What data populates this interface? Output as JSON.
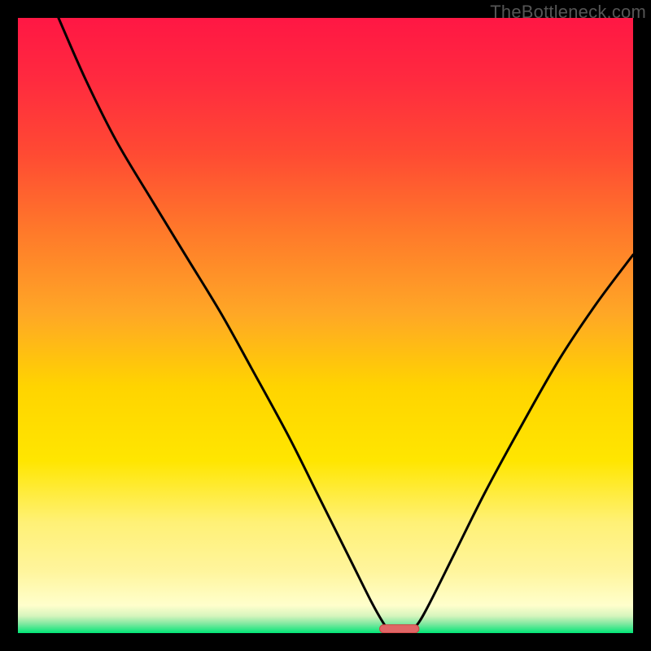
{
  "watermark": "TheBottleneck.com",
  "colors": {
    "frame": "#000000",
    "curve": "#000000",
    "marker_fill": "#e06666",
    "marker_stroke": "#cc4444",
    "gradient_stops": [
      {
        "offset": 0.0,
        "color": "#ff1744"
      },
      {
        "offset": 0.1,
        "color": "#ff2a3f"
      },
      {
        "offset": 0.22,
        "color": "#ff4a33"
      },
      {
        "offset": 0.35,
        "color": "#ff7a2a"
      },
      {
        "offset": 0.48,
        "color": "#ffa726"
      },
      {
        "offset": 0.6,
        "color": "#ffd400"
      },
      {
        "offset": 0.72,
        "color": "#ffe600"
      },
      {
        "offset": 0.82,
        "color": "#fff176"
      },
      {
        "offset": 0.9,
        "color": "#fff59d"
      },
      {
        "offset": 0.955,
        "color": "#ffffcc"
      },
      {
        "offset": 0.972,
        "color": "#d7f5bd"
      },
      {
        "offset": 0.985,
        "color": "#7fe8a0"
      },
      {
        "offset": 1.0,
        "color": "#00e676"
      }
    ]
  },
  "chart_data": {
    "type": "line",
    "title": "",
    "xlabel": "",
    "ylabel": "",
    "xlim": [
      0,
      100
    ],
    "ylim": [
      0,
      100
    ],
    "curve": [
      {
        "x": 6.6,
        "y": 100.0
      },
      {
        "x": 11.0,
        "y": 90.0
      },
      {
        "x": 16.0,
        "y": 80.0
      },
      {
        "x": 22.0,
        "y": 70.0
      },
      {
        "x": 27.5,
        "y": 61.0
      },
      {
        "x": 33.0,
        "y": 52.0
      },
      {
        "x": 38.0,
        "y": 43.0
      },
      {
        "x": 44.0,
        "y": 32.0
      },
      {
        "x": 49.0,
        "y": 22.0
      },
      {
        "x": 54.0,
        "y": 12.0
      },
      {
        "x": 57.5,
        "y": 5.0
      },
      {
        "x": 59.5,
        "y": 1.5
      },
      {
        "x": 60.5,
        "y": 0.4
      },
      {
        "x": 62.0,
        "y": 0.0
      },
      {
        "x": 63.5,
        "y": 0.4
      },
      {
        "x": 65.0,
        "y": 1.5
      },
      {
        "x": 67.0,
        "y": 5.0
      },
      {
        "x": 71.0,
        "y": 13.0
      },
      {
        "x": 76.0,
        "y": 23.0
      },
      {
        "x": 82.0,
        "y": 34.0
      },
      {
        "x": 88.0,
        "y": 44.5
      },
      {
        "x": 94.0,
        "y": 53.5
      },
      {
        "x": 100.0,
        "y": 61.5
      }
    ],
    "marker": {
      "x_center": 62.0,
      "y": 0.7,
      "half_width": 3.2
    }
  }
}
